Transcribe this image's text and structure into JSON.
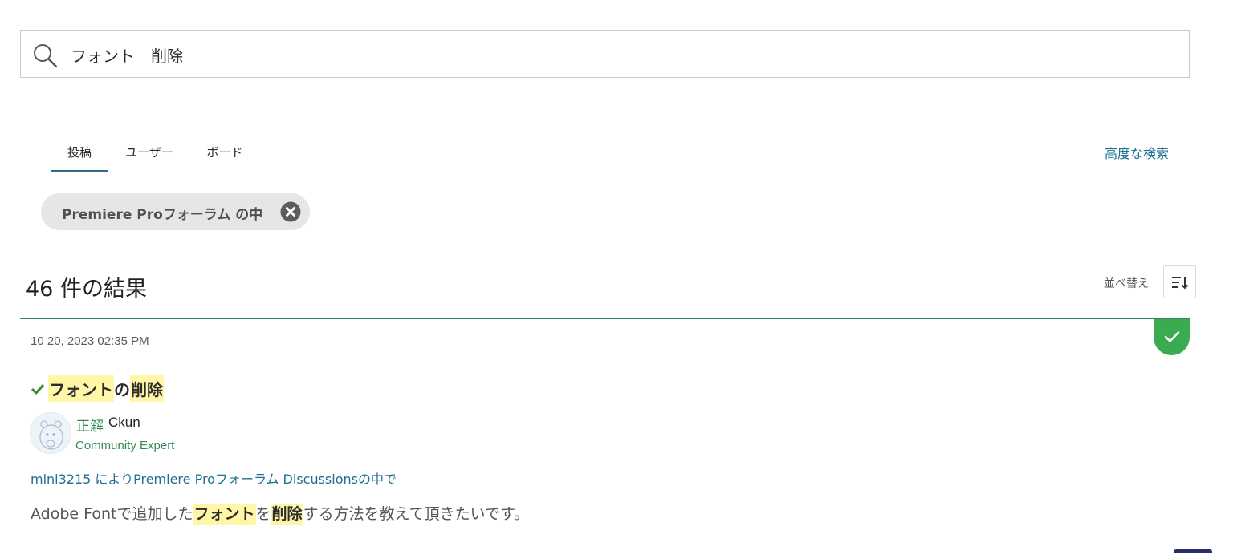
{
  "search": {
    "query": "フォント　削除",
    "icon": "search-icon"
  },
  "tabs": [
    {
      "label": "投稿",
      "active": true
    },
    {
      "label": "ユーザー",
      "active": false
    },
    {
      "label": "ボード",
      "active": false
    }
  ],
  "advanced_search_label": "高度な検索",
  "filter": {
    "label": "Premiere Proフォーラム の中",
    "close_icon": "close-icon"
  },
  "results": {
    "title": "46 件の結果",
    "sort_label": "並べ替え",
    "sort_icon": "sort-icon"
  },
  "post": {
    "date": "10 20, 2023 02:35 PM",
    "title_parts": [
      "フォント",
      "の",
      "削除"
    ],
    "solution_label": "正解",
    "author_name": "Ckun",
    "author_role": "Community Expert",
    "meta": "mini3215 によりPremiere Proフォーラム Discussionsの中で",
    "snippet_parts": [
      "Adobe Fontで追加した",
      "フォント",
      "を",
      "削除",
      "する方法を教えて頂きたいです。"
    ],
    "solved": true
  },
  "colors": {
    "accent_blue": "#1f6f91",
    "solved_green": "#3bab52",
    "highlight": "#fff6a8",
    "expert_green": "#2e8b57"
  }
}
